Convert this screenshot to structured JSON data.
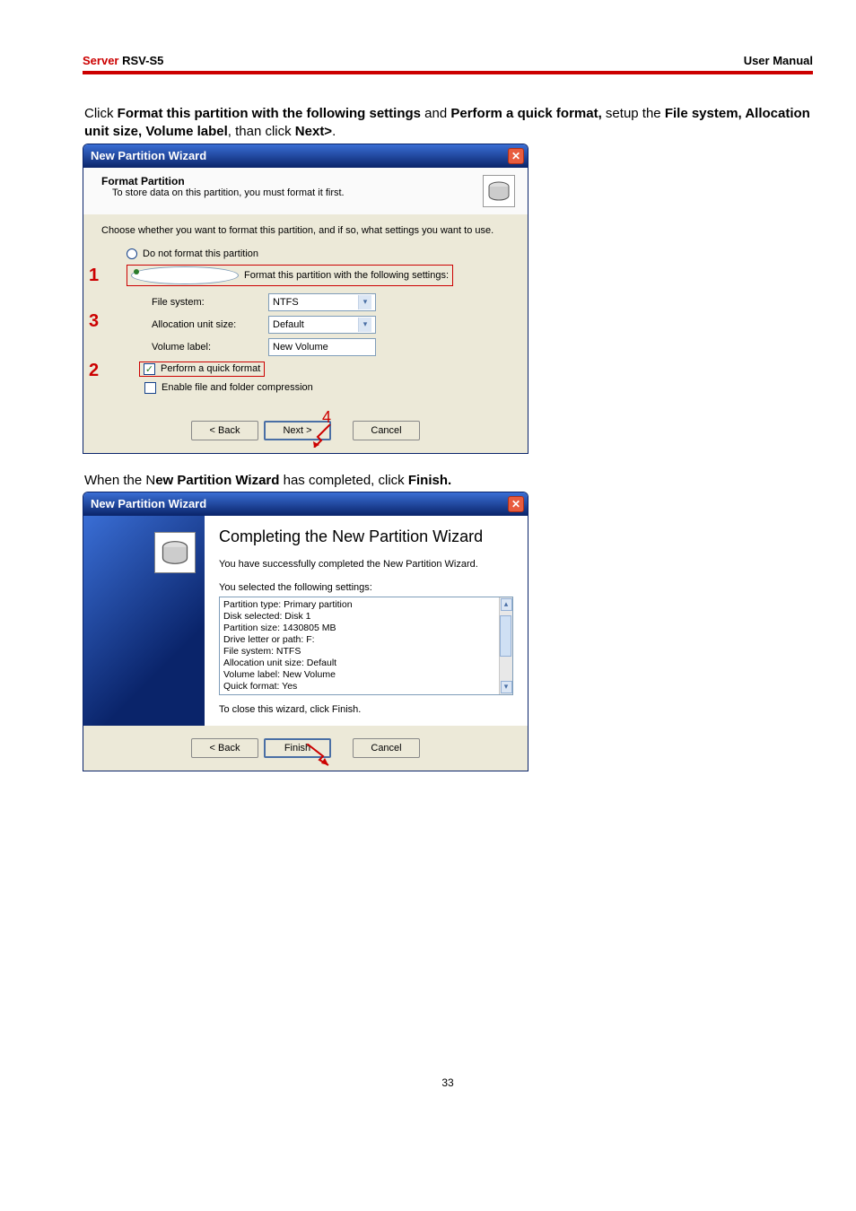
{
  "header": {
    "server": "Server",
    "model": " RSV-S5",
    "right": "User Manual"
  },
  "intro1": {
    "pre": "Click ",
    "b1": "Format this partition with the following settings",
    "mid1": " and ",
    "b2": "Perform a quick format,",
    "mid2": " setup the ",
    "b3": "File system, Allocation unit size, Volume label",
    "mid3": ", than click ",
    "b4": "Next>",
    "end": "."
  },
  "win1": {
    "title": "New Partition Wizard",
    "lead_title": "Format Partition",
    "lead_sub": "To store data on this partition, you must format it first.",
    "prompt": "Choose whether you want to format this partition, and if so, what settings you want to use.",
    "opt_no": "Do not format this partition",
    "opt_yes": "Format this partition with the following settings:",
    "fs_label": "File system:",
    "fs_val": "NTFS",
    "au_label": "Allocation unit size:",
    "au_val": "Default",
    "vl_label": "Volume label:",
    "vl_val": "New Volume",
    "chk_quick": "Perform a quick format",
    "chk_comp": "Enable file and folder compression",
    "btn_back": "< Back",
    "btn_next": "Next >",
    "btn_cancel": "Cancel",
    "n1": "1",
    "n2": "2",
    "n3": "3",
    "n4": "4"
  },
  "intro2": {
    "pre": "When the N",
    "b1": "ew Partition Wizard",
    "mid": " has completed, click ",
    "b2": "Finish."
  },
  "win2": {
    "title": "New Partition Wizard",
    "h": "Completing the New Partition Wizard",
    "done": "You have successfully completed the New Partition Wizard.",
    "sel": "You selected the following settings:",
    "lines": [
      "Partition type: Primary partition",
      "Disk selected: Disk 1",
      "Partition size: 1430805 MB",
      "Drive letter or path: F:",
      "File system: NTFS",
      "Allocation unit size: Default",
      "Volume label: New Volume",
      "Quick format: Yes"
    ],
    "close": "To close this wizard, click Finish.",
    "btn_back": "< Back",
    "btn_finish": "Finish",
    "btn_cancel": "Cancel"
  },
  "pagenum": "33"
}
